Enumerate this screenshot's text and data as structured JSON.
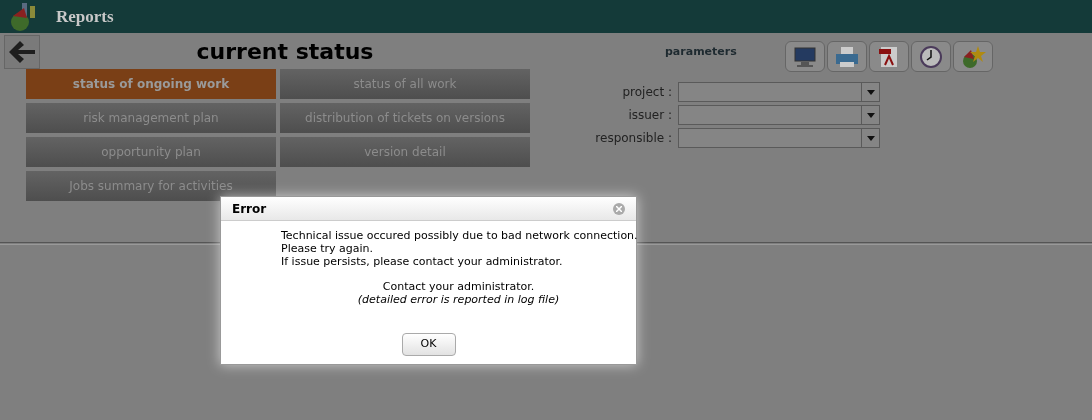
{
  "app": {
    "title": "Reports"
  },
  "page_title": "current status",
  "report_buttons": [
    {
      "label": "status of ongoing work",
      "selected": true
    },
    {
      "label": "status of all work",
      "selected": false
    },
    {
      "label": "risk management plan",
      "selected": false
    },
    {
      "label": "distribution of tickets on versions",
      "selected": false
    },
    {
      "label": "opportunity plan",
      "selected": false
    },
    {
      "label": "version detail",
      "selected": false
    },
    {
      "label": "Jobs summary for activities",
      "selected": false
    }
  ],
  "parameters": {
    "title": "parameters",
    "fields": [
      {
        "label": "project :"
      },
      {
        "label": "issuer :"
      },
      {
        "label": "responsible :"
      }
    ]
  },
  "dialog": {
    "title": "Error",
    "lines": [
      "Technical issue occured possibly due to bad network connection.",
      "Please try again.",
      "If issue persists, please contact your administrator."
    ],
    "contact": "Contact your administrator.",
    "detail": "(detailed error is reported in log file)",
    "button": "OK"
  }
}
